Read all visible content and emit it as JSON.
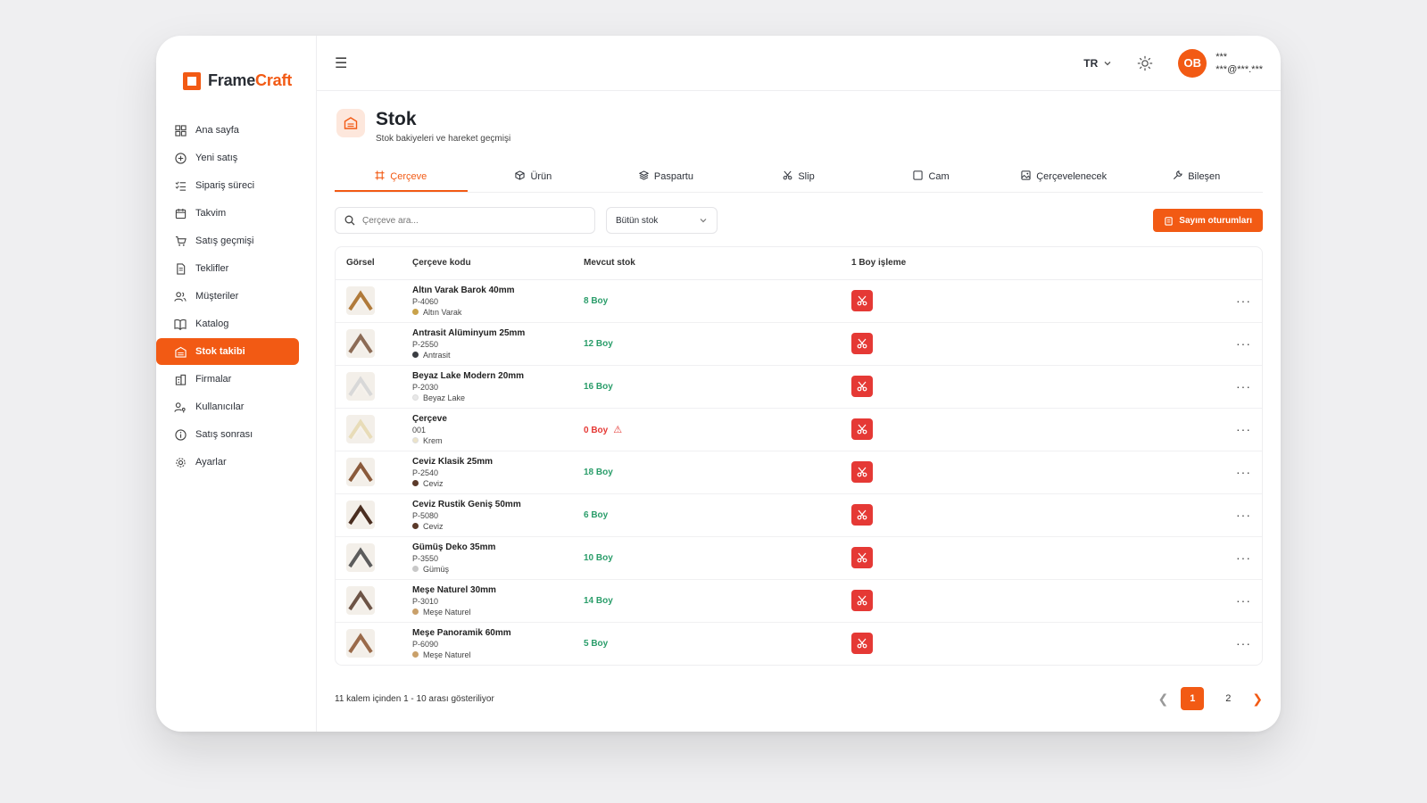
{
  "brand": {
    "name_part1": "Frame",
    "name_part2": "Craft",
    "accent": "#f25a14"
  },
  "sidebar": {
    "items": [
      {
        "label": "Ana sayfa",
        "icon": "dashboard-icon"
      },
      {
        "label": "Yeni satış",
        "icon": "plus-circle-icon"
      },
      {
        "label": "Sipariş süreci",
        "icon": "checklist-icon"
      },
      {
        "label": "Takvim",
        "icon": "calendar-icon"
      },
      {
        "label": "Satış geçmişi",
        "icon": "cart-icon"
      },
      {
        "label": "Teklifler",
        "icon": "document-icon"
      },
      {
        "label": "Müşteriler",
        "icon": "users-icon"
      },
      {
        "label": "Katalog",
        "icon": "book-icon"
      },
      {
        "label": "Stok takibi",
        "icon": "warehouse-icon",
        "active": true
      },
      {
        "label": "Firmalar",
        "icon": "building-icon"
      },
      {
        "label": "Kullanıcılar",
        "icon": "user-key-icon"
      },
      {
        "label": "Satış sonrası",
        "icon": "info-icon"
      },
      {
        "label": "Ayarlar",
        "icon": "gear-icon"
      }
    ]
  },
  "topbar": {
    "lang": "TR",
    "avatar_initials": "OB",
    "user_name": "***",
    "user_email": "***@***.***"
  },
  "page": {
    "title": "Stok",
    "subtitle": "Stok bakiyeleri ve hareket geçmişi"
  },
  "tabs": [
    {
      "label": "Çerçeve",
      "icon": "frame-icon",
      "active": true
    },
    {
      "label": "Ürün",
      "icon": "box-icon"
    },
    {
      "label": "Paspartu",
      "icon": "layers-icon"
    },
    {
      "label": "Slip",
      "icon": "scissors-icon"
    },
    {
      "label": "Cam",
      "icon": "square-icon"
    },
    {
      "label": "Çerçevelenecek",
      "icon": "image-icon"
    },
    {
      "label": "Bileşen",
      "icon": "wrench-icon"
    }
  ],
  "filters": {
    "search_placeholder": "Çerçeve ara...",
    "stock_filter": "Bütün stok",
    "count_button": "Sayım oturumları"
  },
  "table": {
    "headers": {
      "image": "Görsel",
      "code": "Çerçeve kodu",
      "stock": "Mevcut stok",
      "process": "1 Boy işleme"
    },
    "rows": [
      {
        "name": "Altın Varak Barok 40mm",
        "code": "P-4060",
        "color": "Altın Varak",
        "dot": "#c9a24a",
        "stock": "8 Boy",
        "zero": false,
        "frame": "#b07a3a"
      },
      {
        "name": "Antrasit Alüminyum 25mm",
        "code": "P-2550",
        "color": "Antrasit",
        "dot": "#3a3d42",
        "stock": "12 Boy",
        "zero": false,
        "frame": "#8c6b55"
      },
      {
        "name": "Beyaz Lake Modern 20mm",
        "code": "P-2030",
        "color": "Beyaz Lake",
        "dot": "#e8e8e8",
        "stock": "16 Boy",
        "zero": false,
        "frame": "#d8d8d8"
      },
      {
        "name": "Çerçeve",
        "code": "001",
        "color": "Krem",
        "dot": "#ece3c8",
        "stock": "0 Boy",
        "zero": true,
        "frame": "#e8dcb8"
      },
      {
        "name": "Ceviz Klasik 25mm",
        "code": "P-2540",
        "color": "Ceviz",
        "dot": "#5b3a2a",
        "stock": "18 Boy",
        "zero": false,
        "frame": "#8a5a3b"
      },
      {
        "name": "Ceviz Rustik Geniş 50mm",
        "code": "P-5080",
        "color": "Ceviz",
        "dot": "#5b3a2a",
        "stock": "6 Boy",
        "zero": false,
        "frame": "#4a2e20"
      },
      {
        "name": "Gümüş Deko 35mm",
        "code": "P-3550",
        "color": "Gümüş",
        "dot": "#c8c8c8",
        "stock": "10 Boy",
        "zero": false,
        "frame": "#5c5c5c"
      },
      {
        "name": "Meşe Naturel 30mm",
        "code": "P-3010",
        "color": "Meşe Naturel",
        "dot": "#c9a06a",
        "stock": "14 Boy",
        "zero": false,
        "frame": "#6d5446"
      },
      {
        "name": "Meşe Panoramik 60mm",
        "code": "P-6090",
        "color": "Meşe Naturel",
        "dot": "#c9a06a",
        "stock": "5 Boy",
        "zero": false,
        "frame": "#9a6a4a"
      }
    ]
  },
  "footer": {
    "summary": "11 kalem içinden 1 - 10 arası gösteriliyor",
    "pages": [
      "1",
      "2"
    ],
    "current_page": "1"
  }
}
